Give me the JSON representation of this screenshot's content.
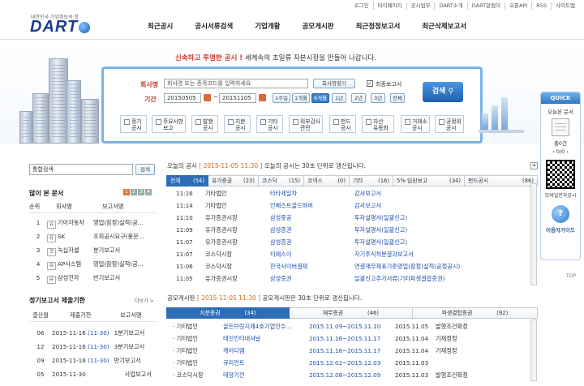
{
  "util_links": [
    "로그인",
    "마이페이지",
    "공시업무",
    "DART소개",
    "DART알림이",
    "오픈API",
    "RSS",
    "사이트맵"
  ],
  "logo": {
    "tagline": "대한민국 기업정보의 창",
    "text": "DART"
  },
  "gnav": [
    "최근공시",
    "공시서류검색",
    "기업개황",
    "공모게시판",
    "최근정정보고서",
    "최근삭제보고서"
  ],
  "slogan": {
    "red": "신속하고 투명한 공시 !",
    "rest": "세계속의 초일류 자본시장을 만들어 나갑니다."
  },
  "search": {
    "company_label": "회사명",
    "company_placeholder": "회사명 또는 종목코드를 입력하세요",
    "company_list_btn": "회사명찾기",
    "final_report_label": "최종보고서",
    "period_label": "기간",
    "date_from": "20150505",
    "date_to": "20151105",
    "periods": [
      "1주일",
      "1개월",
      "6개월",
      "1년",
      "2년",
      "3년",
      "전체"
    ],
    "active_period": "6개월",
    "search_btn": "검색",
    "types": [
      "정기\n공시",
      "주요사항\n보고",
      "발행\n공시",
      "지분\n공시",
      "기타\n공시",
      "외부감사\n관련",
      "펀드\n공시",
      "자산\n유동화",
      "거래소\n공시",
      "공정위\n공시"
    ]
  },
  "quick": {
    "header": "QUICK",
    "item1": "오늘본 문서",
    "count": "총0건",
    "page": "0/0",
    "qr_label": "모바일전자공시",
    "guide_label": "이용자가이드",
    "top": "TOP"
  },
  "integrated_search": {
    "label": "통합검색",
    "btn": "검색"
  },
  "popular": {
    "title": "많이 본 문서",
    "pages": [
      "1",
      "2",
      "3",
      "4"
    ],
    "headers": [
      "순위",
      "회사명",
      "보고서명"
    ],
    "rows": [
      {
        "rank": "1",
        "badge": "유",
        "company": "기아자동차",
        "report": "영업(잠정)실적(공..."
      },
      {
        "rank": "2",
        "badge": "유",
        "company": "SK",
        "report": "조회공시요구(풍문..."
      },
      {
        "rank": "3",
        "badge": "코",
        "company": "녹십자셀",
        "report": "분기보고서"
      },
      {
        "rank": "4",
        "badge": "유",
        "company": "AP시스템",
        "report": "영업(잠정)실적(공..."
      },
      {
        "rank": "5",
        "badge": "유",
        "company": "삼성전자",
        "report": "반기보고서"
      }
    ]
  },
  "deadline": {
    "title": "정기보고서 제출기한",
    "more": "더보기 >",
    "headers": [
      "결산월",
      "제출기한",
      "보고서명"
    ],
    "rows": [
      {
        "month": "06",
        "date": "2015-11-16",
        "time": "(11-30)",
        "report": "1분기보고서"
      },
      {
        "month": "12",
        "date": "2015-11-16",
        "time": "(11-30)",
        "report": "3분기보고서"
      },
      {
        "month": "09",
        "date": "2015-11-16",
        "time": "(11-30)",
        "report": "반기보고서"
      },
      {
        "month": "05",
        "date": "2015-11-30",
        "time": "",
        "report": "사업보고서"
      }
    ]
  },
  "today": {
    "prefix": "오늘의 공시",
    "stamp": "[ 2015-11-05 11:30 ]",
    "suffix": "오늘의 공시는 30초 단위로 갱신됩니다.",
    "tabs": [
      {
        "name": "전체",
        "count": "(54)"
      },
      {
        "name": "유가증권",
        "count": "(23)"
      },
      {
        "name": "코스닥",
        "count": "(15)"
      },
      {
        "name": "코넥스",
        "count": "(0)"
      },
      {
        "name": "기타",
        "count": "(16)"
      },
      {
        "name": "5%·임원보고",
        "count": "(34)"
      },
      {
        "name": "펀드공시",
        "count": "(86)"
      }
    ],
    "rows": [
      {
        "time": "11:16",
        "market": "기타법인",
        "company": "타타제일차",
        "report": "감사보고서"
      },
      {
        "time": "11:14",
        "market": "기타법인",
        "company": "인베스트골드하버",
        "report": "감사보고서"
      },
      {
        "time": "11:10",
        "market": "유가증권시장",
        "company": "삼성중공",
        "report": "투자설명서(일괄신고)"
      },
      {
        "time": "11:09",
        "market": "유가증권시장",
        "company": "삼성증권",
        "report": "투자설명서(일괄신고)"
      },
      {
        "time": "11:07",
        "market": "유가증권시장",
        "company": "삼성증권",
        "report": "투자설명서(일괄신고)"
      },
      {
        "time": "11:07",
        "market": "코스닥시장",
        "company": "티에스이",
        "report": "자기주식처분결과보고서"
      },
      {
        "time": "11:06",
        "market": "코스닥시장",
        "company": "한국사이버결제",
        "report": "연결재무제표기준영업(잠정)실적(공정공시)"
      },
      {
        "time": "11:05",
        "market": "유가증권시장",
        "company": "삼성증권",
        "report": "일괄신고추가서류(기타파생결합증권)"
      }
    ]
  },
  "ipo": {
    "prefix": "공모게시판",
    "stamp": "[ 2015-11-05 11:30 ]",
    "suffix": "공모게시판은 30초 단위로 갱신됩니다.",
    "tabs": [
      {
        "name": "지분증권",
        "count": "(34)"
      },
      {
        "name": "채무증권",
        "count": "(46)"
      },
      {
        "name": "파생결합증권",
        "count": "(92)"
      }
    ],
    "rows": [
      {
        "market": "기타법인",
        "company": "골든브릿지제4호기업인수...",
        "period": "2015.11.09~2015.11.10",
        "date": "2015.11.05",
        "status": "발행조건확정"
      },
      {
        "market": "기타법인",
        "company": "테진인터내셔날",
        "period": "2015.11.16~2015.11.17",
        "date": "2015.11.04",
        "status": "기재정정"
      },
      {
        "market": "기타법인",
        "company": "케어디엠",
        "period": "2015.11.16~2015.11.17",
        "date": "2015.11.04",
        "status": "기재정정"
      },
      {
        "market": "기타법인",
        "company": "큐리언트",
        "period": "2015.12.02~2015.12.03",
        "date": "2015.11.03",
        "status": ""
      },
      {
        "market": "코스닥시장",
        "company": "태양기전",
        "period": "2015.12.08~2015.12.09",
        "date": "2015.11.03",
        "status": "발행조건확정"
      }
    ]
  }
}
